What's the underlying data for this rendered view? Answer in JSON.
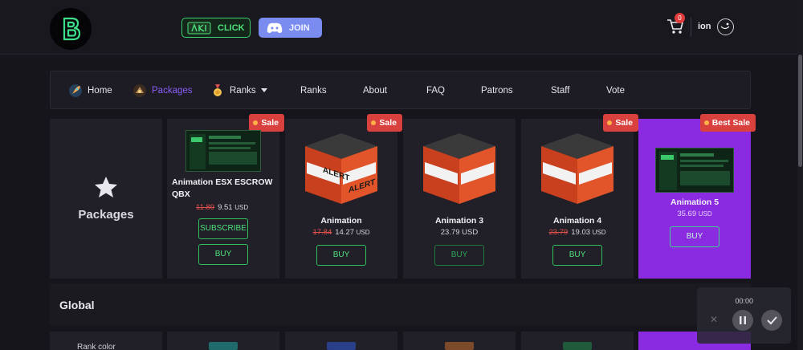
{
  "header": {
    "click_label": "CLICK",
    "join_label": "JOIN",
    "cart_count": "0",
    "username": "ion"
  },
  "nav": {
    "items": [
      {
        "label": "Home"
      },
      {
        "label": "Packages"
      },
      {
        "label": "Ranks"
      },
      {
        "label": "Ranks"
      },
      {
        "label": "About"
      },
      {
        "label": "FAQ"
      },
      {
        "label": "Patrons"
      },
      {
        "label": "Staff"
      },
      {
        "label": "Vote"
      }
    ]
  },
  "packages_card": {
    "title": "Packages"
  },
  "products": [
    {
      "badge": "Sale",
      "name": "Animation ESX ESCROW QBX",
      "old_price": "11.89",
      "price": "9.51",
      "currency": "USD",
      "subscribe_label": "SUBSCRIBE",
      "buy_label": "BUY"
    },
    {
      "badge": "Sale",
      "name": "Animation",
      "old_price": "17.84",
      "price": "14.27",
      "currency": "USD",
      "buy_label": "BUY"
    },
    {
      "name": "Animation 3",
      "price": "23.79",
      "currency": "USD",
      "buy_label": "BUY"
    },
    {
      "badge": "Sale",
      "name": "Animation 4",
      "old_price": "23.79",
      "price": "19.03",
      "currency": "USD",
      "buy_label": "BUY"
    },
    {
      "badge": "Best Sale",
      "name": "Animation 5",
      "price": "35.69",
      "currency": "USD",
      "buy_label": "BUY"
    }
  ],
  "global_section": {
    "title": "Global",
    "rank_color_label": "Rank color"
  },
  "player": {
    "time": "00:00"
  },
  "colors": {
    "accent_purple": "#8a2be2",
    "sale_red": "#d9413e",
    "buy_green": "#2fbf5d"
  }
}
